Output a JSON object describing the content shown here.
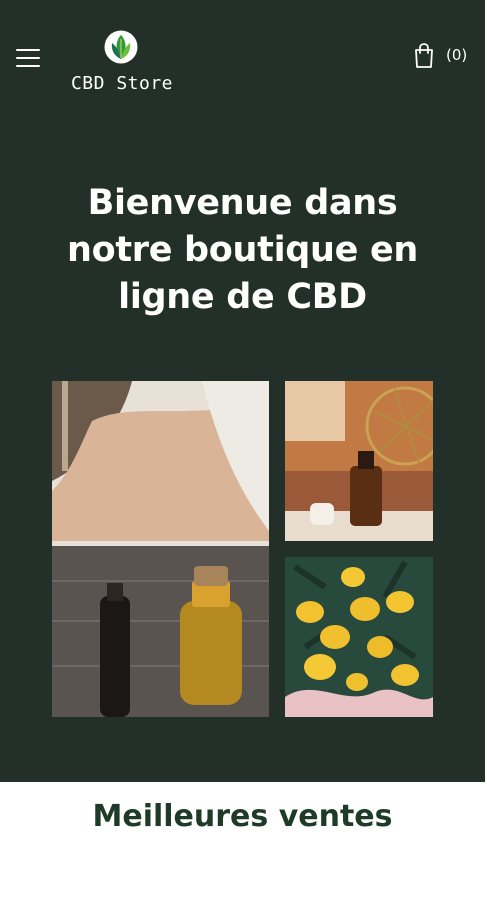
{
  "header": {
    "menu_icon": "hamburger-menu-icon",
    "logo_icon": "leaf-logo-icon",
    "logo_text": "CBD Store",
    "cart_icon": "shopping-bag-icon",
    "cart_count": "(0)"
  },
  "hero": {
    "title": "Bienvenue dans notre boutique en ligne de CBD",
    "images": [
      {
        "name": "oil-bottles-photo"
      },
      {
        "name": "bottle-photo"
      },
      {
        "name": "lemons-photo"
      }
    ]
  },
  "sections": {
    "best_sellers_title": "Meilleures ventes"
  },
  "colors": {
    "hero_background": "#223029",
    "heading_green": "#1d3b27",
    "text_white": "#ffffff"
  }
}
